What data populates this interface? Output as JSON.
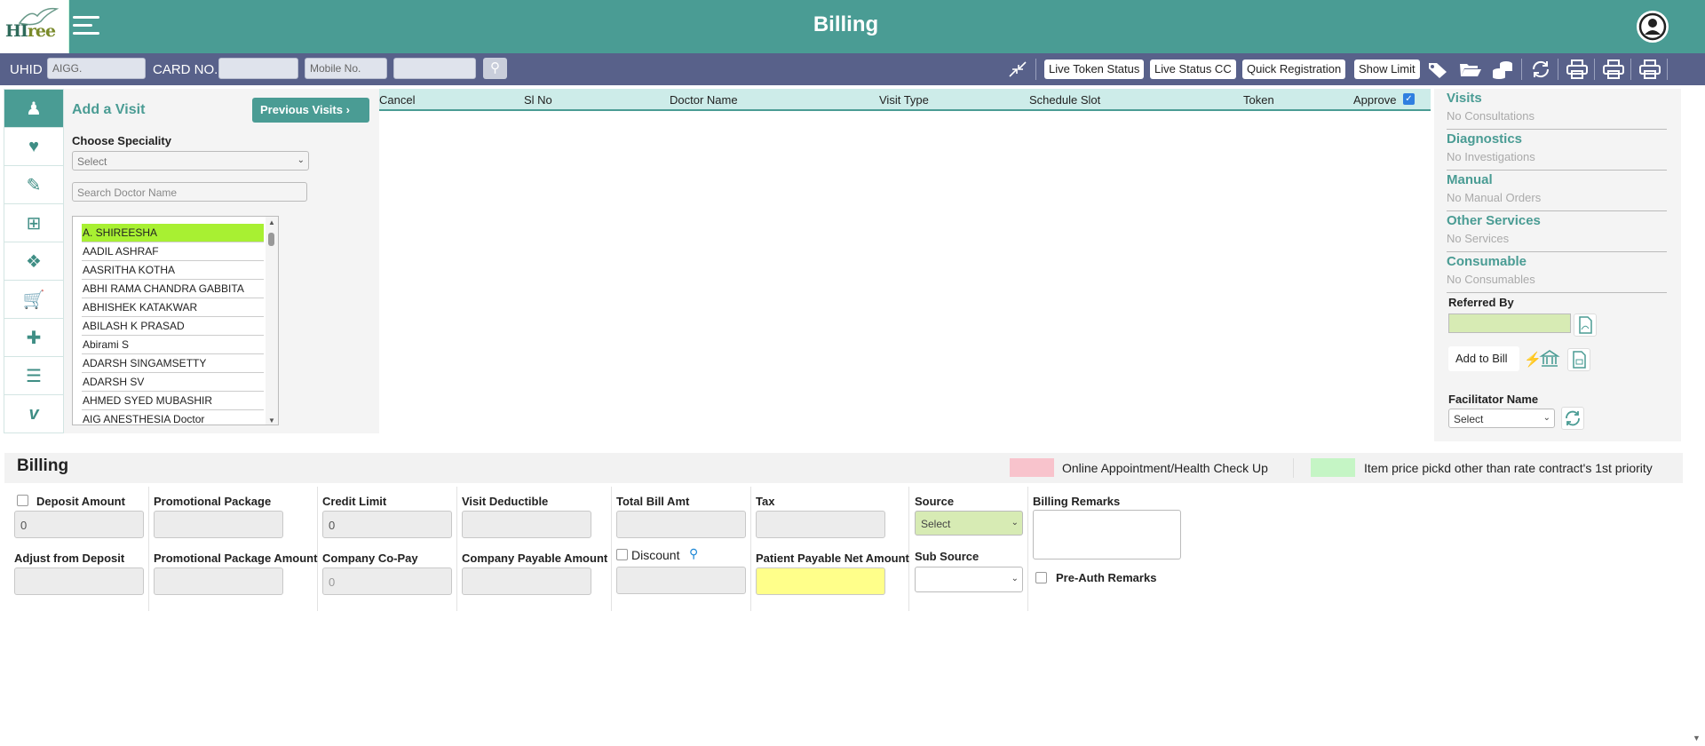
{
  "header": {
    "title": "Billing",
    "logo_text_1": "HI",
    "logo_text_2": "ree"
  },
  "filters": {
    "uhid_label": "UHID",
    "uhid_value": "AIGG.",
    "card_label": "CARD NO.",
    "card_value": "",
    "mobile_placeholder": "Mobile No.",
    "mobile_value": ""
  },
  "toolbar": {
    "live_token_status": "Live Token Status",
    "live_status_cc": "Live Status CC",
    "quick_registration": "Quick Registration",
    "show_limit": "Show Limit"
  },
  "add_visit": {
    "title": "Add a Visit",
    "previous_visits": "Previous Visits",
    "choose_speciality_label": "Choose Speciality",
    "speciality_selected": "Select",
    "doctor_search_placeholder": "Search Doctor Name",
    "doctors": [
      "A. SHIREESHA",
      "AADIL ASHRAF",
      "AASRITHA KOTHA",
      "ABHI RAMA CHANDRA GABBITA",
      "ABHISHEK KATAKWAR",
      "ABILASH K PRASAD",
      "Abirami S",
      "ADARSH SINGAMSETTY",
      "ADARSH SV",
      "AHMED SYED MUBASHIR",
      "AIG ANESTHESIA Doctor"
    ]
  },
  "visit_table": {
    "columns": [
      "Cancel",
      "Sl No",
      "Doctor Name",
      "Visit Type",
      "Schedule Slot",
      "Token",
      "Approve"
    ],
    "approve_checked": true
  },
  "right_panel": {
    "sections": [
      {
        "title": "Visits",
        "sub": "No Consultations"
      },
      {
        "title": "Diagnostics",
        "sub": "No Investigations"
      },
      {
        "title": "Manual",
        "sub": "No Manual Orders"
      },
      {
        "title": "Other Services",
        "sub": "No Services"
      },
      {
        "title": "Consumable",
        "sub": "No Consumables"
      }
    ],
    "referred_by_label": "Referred By",
    "add_to_bill": "Add to Bill",
    "facilitator_label": "Facilitator Name",
    "facilitator_selected": "Select"
  },
  "billing": {
    "title": "Billing",
    "legend_1": "Online Appointment/Health Check Up",
    "legend_1_color": "#f8c3cc",
    "legend_2": "Item price pickd other than rate contract's 1st priority",
    "legend_2_color": "#c5f5c5",
    "deposit_amount_label": "Deposit Amount",
    "deposit_amount_value": "0",
    "promotional_package_label": "Promotional Package",
    "credit_limit_label": "Credit Limit",
    "credit_limit_value": "0",
    "visit_deductible_label": "Visit Deductible",
    "total_bill_amt_label": "Total Bill Amt",
    "tax_label": "Tax",
    "source_label": "Source",
    "source_selected": "Select",
    "billing_remarks_label": "Billing Remarks",
    "adjust_from_deposit_label": "Adjust from Deposit",
    "promotional_package_amount_label": "Promotional Package Amount",
    "company_copay_label": "Company Co-Pay",
    "company_copay_value": "0",
    "company_payable_label": "Company Payable Amount",
    "discount_label": "Discount",
    "patient_payable_label": "Patient Payable Net Amount",
    "sub_source_label": "Sub Source",
    "pre_auth_label": "Pre-Auth Remarks"
  },
  "colors": {
    "brand": "#4a9c94",
    "filterbar": "#58618a",
    "selected_doctor": "#a8f032",
    "patient_payable_bg": "#ffff8a"
  }
}
